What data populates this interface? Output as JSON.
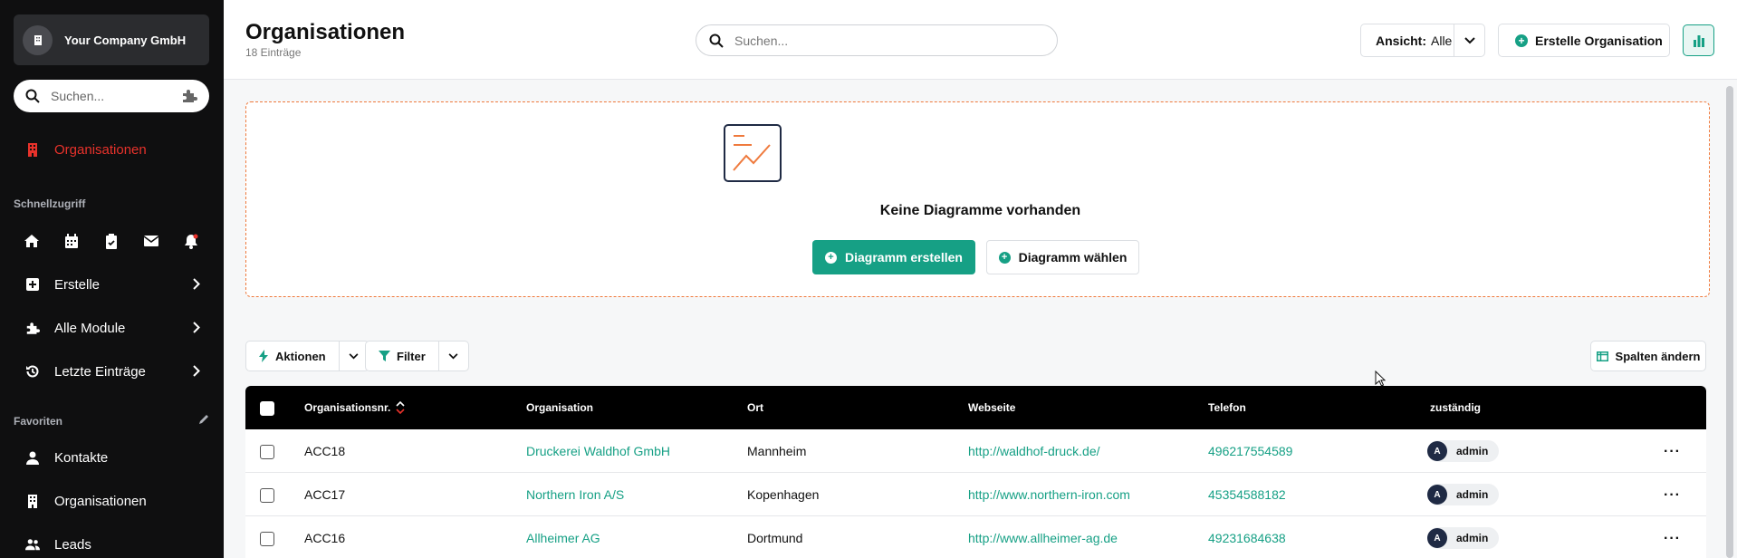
{
  "sidebar": {
    "company": "Your Company GmbH",
    "search_placeholder": "Suchen...",
    "active_item": "Organisationen",
    "quick_label": "Schnellzugriff",
    "menu": [
      {
        "label": "Erstelle",
        "icon": "plus-square-icon"
      },
      {
        "label": "Alle Module",
        "icon": "puzzle-icon"
      },
      {
        "label": "Letzte Einträge",
        "icon": "history-icon"
      }
    ],
    "favorites_label": "Favoriten",
    "favorites": [
      {
        "label": "Kontakte",
        "icon": "person-icon"
      },
      {
        "label": "Organisationen",
        "icon": "building-icon"
      },
      {
        "label": "Leads",
        "icon": "users-icon"
      }
    ]
  },
  "header": {
    "title": "Organisationen",
    "count": "18 Einträge",
    "search_placeholder": "Suchen...",
    "view_label": "Ansicht:",
    "view_value": "Alle",
    "create_label": "Erstelle Organisation"
  },
  "charts": {
    "empty_text": "Keine Diagramme vorhanden",
    "create_label": "Diagramm erstellen",
    "choose_label": "Diagramm wählen"
  },
  "toolbar": {
    "actions_label": "Aktionen",
    "filter_label": "Filter",
    "columns_label": "Spalten ändern"
  },
  "table": {
    "columns": [
      "Organisationsnr.",
      "Organisation",
      "Ort",
      "Webseite",
      "Telefon",
      "zuständig"
    ],
    "rows": [
      {
        "nr": "ACC18",
        "org": "Druckerei Waldhof GmbH",
        "ort": "Mannheim",
        "web": "http://waldhof-druck.de/",
        "tel": "496217554589",
        "owner": "admin",
        "initial": "A"
      },
      {
        "nr": "ACC17",
        "org": "Northern Iron A/S",
        "ort": "Kopenhagen",
        "web": "http://www.northern-iron.com",
        "tel": "45354588182",
        "owner": "admin",
        "initial": "A"
      },
      {
        "nr": "ACC16",
        "org": "Allheimer AG",
        "ort": "Dortmund",
        "web": "http://www.allheimer-ag.de",
        "tel": "49231684638",
        "owner": "admin",
        "initial": "A"
      }
    ]
  },
  "colors": {
    "accent": "#16a085",
    "active": "#e8322b",
    "dashed": "#ef7a3d"
  }
}
